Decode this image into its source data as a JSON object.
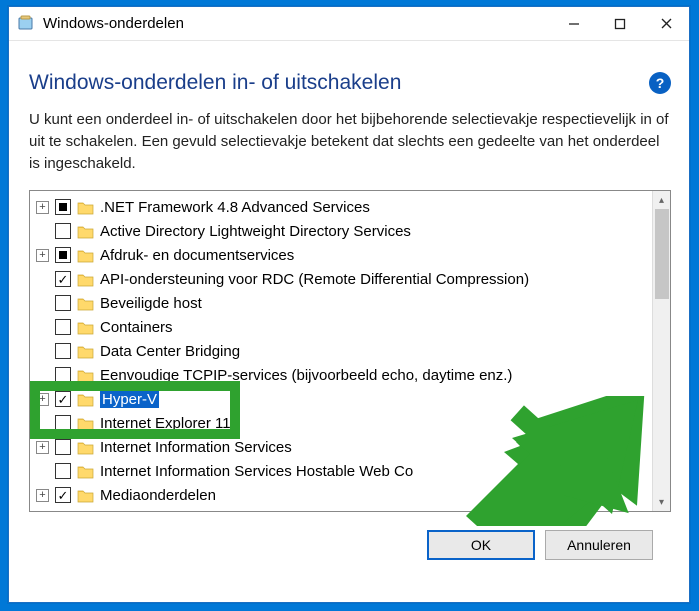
{
  "window": {
    "title": "Windows-onderdelen"
  },
  "heading": "Windows-onderdelen in- of uitschakelen",
  "description": "U kunt een onderdeel in- of uitschakelen door het bijbehorende selectievakje respectievelijk in of uit te schakelen. Een gevuld selectievakje betekent dat slechts een gedeelte van het onderdeel is ingeschakeld.",
  "features": [
    {
      "expand": "+",
      "state": "partial",
      "label": ".NET Framework 4.8 Advanced Services",
      "selected": false
    },
    {
      "expand": "",
      "state": "none",
      "label": "Active Directory Lightweight Directory Services",
      "selected": false
    },
    {
      "expand": "+",
      "state": "partial",
      "label": "Afdruk- en documentservices",
      "selected": false
    },
    {
      "expand": "",
      "state": "checked",
      "label": "API-ondersteuning voor RDC (Remote Differential Compression)",
      "selected": false
    },
    {
      "expand": "",
      "state": "none",
      "label": "Beveiligde host",
      "selected": false
    },
    {
      "expand": "",
      "state": "none",
      "label": "Containers",
      "selected": false
    },
    {
      "expand": "",
      "state": "none",
      "label": "Data Center Bridging",
      "selected": false
    },
    {
      "expand": "",
      "state": "none",
      "label": "Eenvoudige TCPIP-services (bijvoorbeeld echo, daytime enz.)",
      "selected": false
    },
    {
      "expand": "+",
      "state": "checked",
      "label": "Hyper-V",
      "selected": true
    },
    {
      "expand": "",
      "state": "none",
      "label": "Internet Explorer 11",
      "selected": false
    },
    {
      "expand": "+",
      "state": "none",
      "label": "Internet Information Services",
      "selected": false
    },
    {
      "expand": "",
      "state": "none",
      "label": "Internet Information Services Hostable Web Co",
      "selected": false
    },
    {
      "expand": "+",
      "state": "checked",
      "label": "Mediaonderdelen",
      "selected": false
    }
  ],
  "buttons": {
    "ok": "OK",
    "cancel": "Annuleren"
  },
  "annotations": {
    "highlight_feature_index": 8
  }
}
